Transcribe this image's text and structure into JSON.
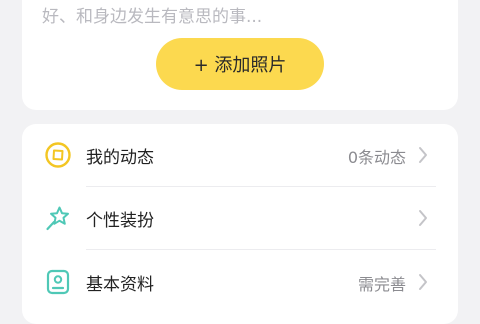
{
  "profile_top": {
    "description": "好、和身边发生有意思的事...",
    "add_photo_label": "+ 添加照片"
  },
  "menu": {
    "items": [
      {
        "label": "我的动态",
        "value": "0条动态",
        "icon": "compass-circle-icon"
      },
      {
        "label": "个性装扮",
        "value": "",
        "icon": "star-wand-icon"
      },
      {
        "label": "基本资料",
        "value": "需完善",
        "icon": "id-card-icon"
      }
    ]
  },
  "colors": {
    "accent": "#fcd94f",
    "icon_yellow": "#f3c623",
    "icon_teal": "#4fc8b6",
    "background": "#f2f2f4",
    "chevron": "#c4c4c8"
  }
}
